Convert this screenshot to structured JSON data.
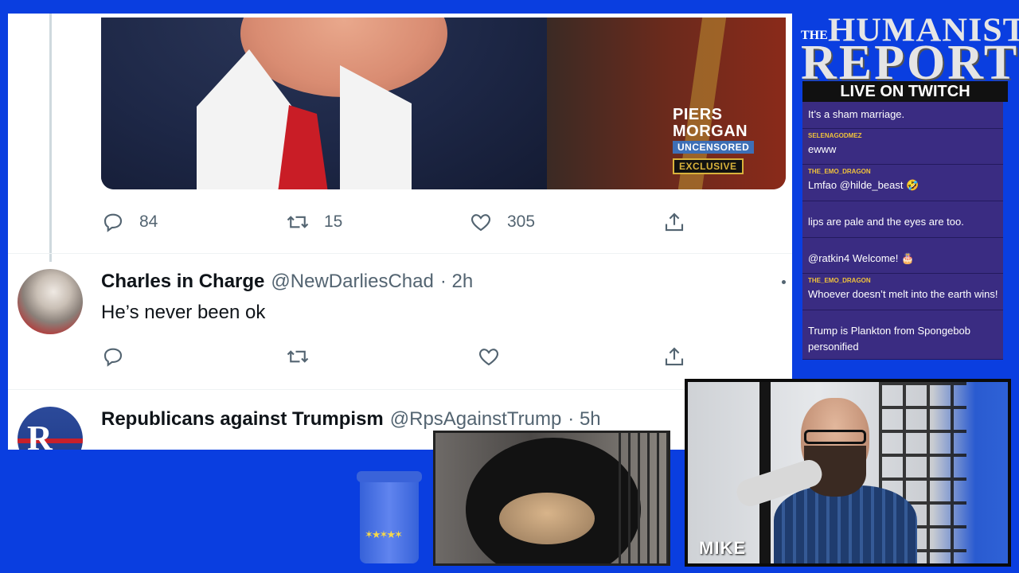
{
  "tweet_top": {
    "media_brand": {
      "line1": "PIERS",
      "line2": "MORGAN",
      "line3": "UNCENSORED",
      "badge": "EXCLUSIVE"
    },
    "replies": "84",
    "retweets": "15",
    "likes": "305"
  },
  "reply_1": {
    "name": "Charles in Charge",
    "handle": "@NewDarliesChad",
    "time": "· 2h",
    "text": "He’s never been ok"
  },
  "reply_2": {
    "name": "Republicans against Trumpism",
    "handle": "@RpsAgainstTrump",
    "time": "· 5h",
    "avatar_letter": "R"
  },
  "branding": {
    "the": "THE",
    "title1": "HUMANIST",
    "title2": "REPORT",
    "live": "LIVE ON TWITCH"
  },
  "chat": [
    {
      "user": "",
      "user_color": "#c8a6ff",
      "text": "It’s a sham marriage."
    },
    {
      "user": "SELENAGODMEZ",
      "user_color": "#f0c23b",
      "text": "ewww"
    },
    {
      "user": "THE_EMO_DRAGON",
      "user_color": "#f0c23b",
      "text": "Lmfao @hilde_beast 🤣"
    },
    {
      "user": "",
      "user_color": "#39d353",
      "text": "lips are pale and the eyes are too."
    },
    {
      "user": "",
      "user_color": "#b084ff",
      "text": "@ratkin4 Welcome! 🎂"
    },
    {
      "user": "THE_EMO_DRAGON",
      "user_color": "#f0c23b",
      "text": "Whoever doesn’t melt into the earth wins!"
    },
    {
      "user": "",
      "user_color": "#39d353",
      "text": "Trump is Plankton from Spongebob personified"
    }
  ],
  "cams": {
    "host_name": "MIKE",
    "cup_stars": "✶★✶★✶"
  },
  "colors": {
    "background": "#0a3ee0",
    "chat_bg": "#3a2c82",
    "twitter_gray": "#536471"
  },
  "icons": [
    "reply-icon",
    "retweet-icon",
    "like-icon",
    "share-icon",
    "more-icon"
  ]
}
